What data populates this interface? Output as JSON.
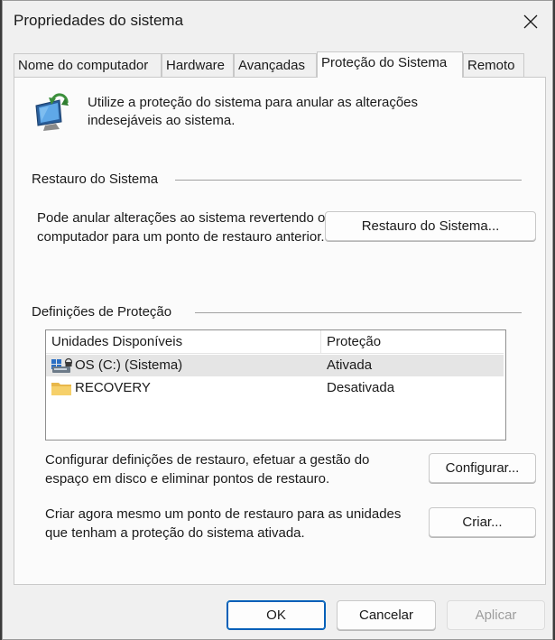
{
  "window": {
    "title": "Propriedades do sistema"
  },
  "tabs": [
    {
      "label": "Nome do computador"
    },
    {
      "label": "Hardware"
    },
    {
      "label": "Avançadas"
    },
    {
      "label": "Proteção do Sistema",
      "active": true
    },
    {
      "label": "Remoto"
    }
  ],
  "intro": {
    "text": "Utilize a proteção do sistema para anular as alterações indesejáveis ao sistema."
  },
  "restore": {
    "heading": "Restauro do Sistema",
    "description": "Pode anular alterações ao sistema revertendo o computador para um ponto de restauro anterior.",
    "button_label": "Restauro do Sistema..."
  },
  "protection": {
    "heading": "Definições de Proteção",
    "columns": [
      "Unidades Disponíveis",
      "Proteção"
    ],
    "drives": [
      {
        "name": "OS (C:) (Sistema)",
        "status": "Ativada",
        "icon": "system-drive-icon",
        "selected": true
      },
      {
        "name": "RECOVERY",
        "status": "Desativada",
        "icon": "folder-icon",
        "selected": false
      }
    ],
    "configure_text": "Configurar definições de restauro, efetuar a gestão do espaço em disco e eliminar pontos de restauro.",
    "configure_button": "Configurar...",
    "create_text": "Criar agora mesmo um ponto de restauro para as unidades que tenham a proteção do sistema ativada.",
    "create_button": "Criar..."
  },
  "footer": {
    "ok": "OK",
    "cancel": "Cancelar",
    "apply": "Aplicar"
  },
  "colors": {
    "accent": "#005fb8",
    "selected_row": "#e5e5e5",
    "disabled_text": "#9d9d9d"
  }
}
